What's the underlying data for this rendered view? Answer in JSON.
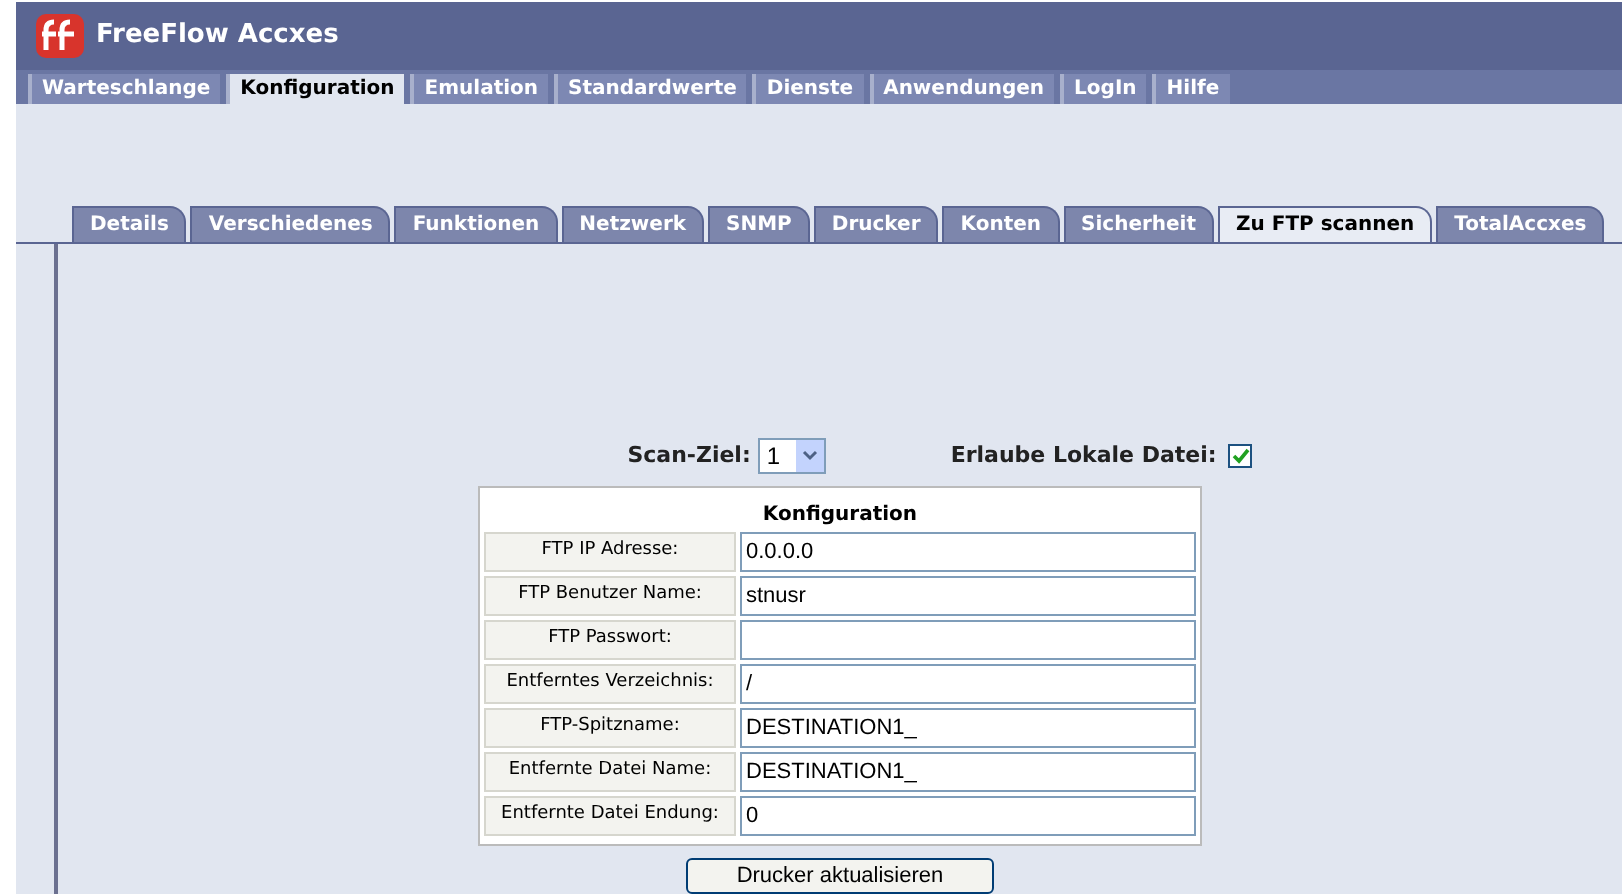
{
  "app": {
    "title": "FreeFlow Accxes"
  },
  "nav_tabs": [
    {
      "label": "Warteschlange",
      "selected": false
    },
    {
      "label": "Konfiguration",
      "selected": true
    },
    {
      "label": "Emulation",
      "selected": false
    },
    {
      "label": "Standardwerte",
      "selected": false
    },
    {
      "label": "Dienste",
      "selected": false
    },
    {
      "label": "Anwendungen",
      "selected": false
    },
    {
      "label": "LogIn",
      "selected": false
    },
    {
      "label": "Hilfe",
      "selected": false
    }
  ],
  "sub_tabs": [
    {
      "label": "Details",
      "selected": false
    },
    {
      "label": "Verschiedenes",
      "selected": false
    },
    {
      "label": "Funktionen",
      "selected": false
    },
    {
      "label": "Netzwerk",
      "selected": false
    },
    {
      "label": "SNMP",
      "selected": false
    },
    {
      "label": "Drucker",
      "selected": false
    },
    {
      "label": "Konten",
      "selected": false
    },
    {
      "label": "Sicherheit",
      "selected": false
    },
    {
      "label": "Zu FTP scannen",
      "selected": true
    },
    {
      "label": "TotalAccxes",
      "selected": false
    }
  ],
  "scan_target": {
    "label": "Scan-Ziel:",
    "value": "1"
  },
  "allow_local_file": {
    "label": "Erlaube Lokale Datei:",
    "checked": true
  },
  "config_table": {
    "title": "Konfiguration",
    "rows": [
      {
        "label": "FTP IP Adresse:",
        "value": "0.0.0.0"
      },
      {
        "label": "FTP Benutzer Name:",
        "value": "stnusr"
      },
      {
        "label": "FTP Passwort:",
        "value": ""
      },
      {
        "label": "Entferntes Verzeichnis:",
        "value": "/"
      },
      {
        "label": "FTP-Spitzname:",
        "value": "DESTINATION1_"
      },
      {
        "label": "Entfernte Datei Name:",
        "value": "DESTINATION1_"
      },
      {
        "label": "Entfernte Datei Endung:",
        "value": "0"
      }
    ]
  },
  "submit_button": "Drucker aktualisieren"
}
